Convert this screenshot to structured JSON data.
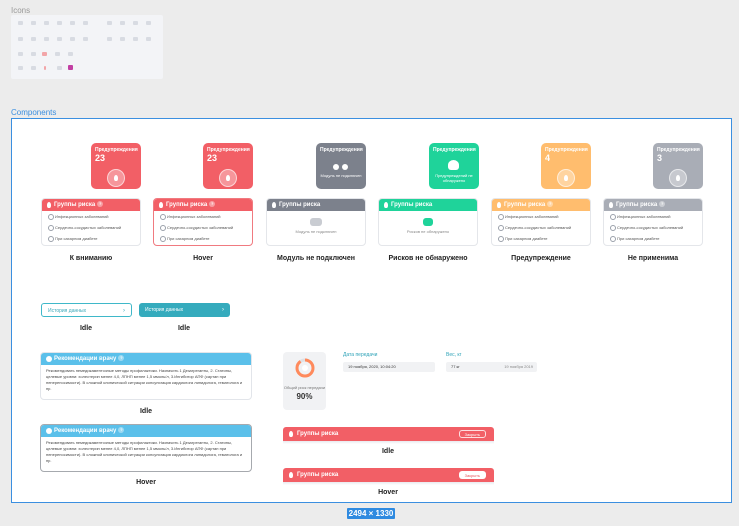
{
  "sections": {
    "icons": "Icons",
    "components": "Components"
  },
  "frame_size": "2494 × 1330",
  "colors": {
    "red": "#f25f66",
    "gray": "#7c818c",
    "green": "#1fd39a",
    "orange": "#ffbd6e",
    "light_gray": "#a9adb6",
    "cyan": "#35abbd",
    "sky": "#5bc0ea"
  },
  "tiles": [
    {
      "title": "Предупреждения",
      "count": "23",
      "icon": "drop-icon"
    },
    {
      "title": "Предупреждения",
      "count": "23",
      "icon": "drop-icon"
    },
    {
      "title": "Предупреждения",
      "caption": "Модуль не подключен",
      "icon": "plug-icon"
    },
    {
      "title": "Предупреждения",
      "caption": "Предупреждений не обнаружено",
      "icon": "heart-icon"
    },
    {
      "title": "Предупреждения",
      "count": "4",
      "icon": "drop-icon"
    },
    {
      "title": "Предупреждения",
      "count": "3",
      "icon": "drop-icon"
    }
  ],
  "risk_cards": {
    "header": "Группы риска",
    "items": [
      "Инфекционных заболеваний",
      "Сердечно-сосудистых заболеваний",
      "При сахарном диабете"
    ],
    "empty_module": "Модуль не подключен",
    "empty_none": "Рисков не обнаружено"
  },
  "states": [
    "К вниманию",
    "Hover",
    "Модуль не подключен",
    "Рисков не обнаружено",
    "Предупреждение",
    "Не применима"
  ],
  "history": {
    "label": "История данных",
    "chevron": "›",
    "states": [
      "Idle",
      "Idle"
    ]
  },
  "doctor": {
    "title": "Рекомендации врачу",
    "text": "Рекомендовать немедикаментозные методы профилактики. Назначить 1 Дезагреганты, 2. Статины, целевые уровни: холестерин менее 4,0, ЛПНП менее 1,5 ммоль/л, 3.Ингибитор АПФ (сартан при непереносимости). В сложной клинической ситуации консультация кардиолога липидолога, гематолога и пр.",
    "states": [
      "Idle",
      "Hover"
    ]
  },
  "overall_risk": {
    "label": "Общий риск передачи",
    "value": "90%",
    "fraction": 0.9
  },
  "fields": {
    "date_label": "Дата передачи",
    "date_value": "19 ноября, 2020, 10:04:20",
    "weight_label": "Вес, кг",
    "weight_value": "77 кг",
    "weight_date": "19 ноября 2019"
  },
  "risk_bar": {
    "title": "Группы риска",
    "button": "Закрыть",
    "states": [
      "Idle",
      "Hover"
    ]
  }
}
